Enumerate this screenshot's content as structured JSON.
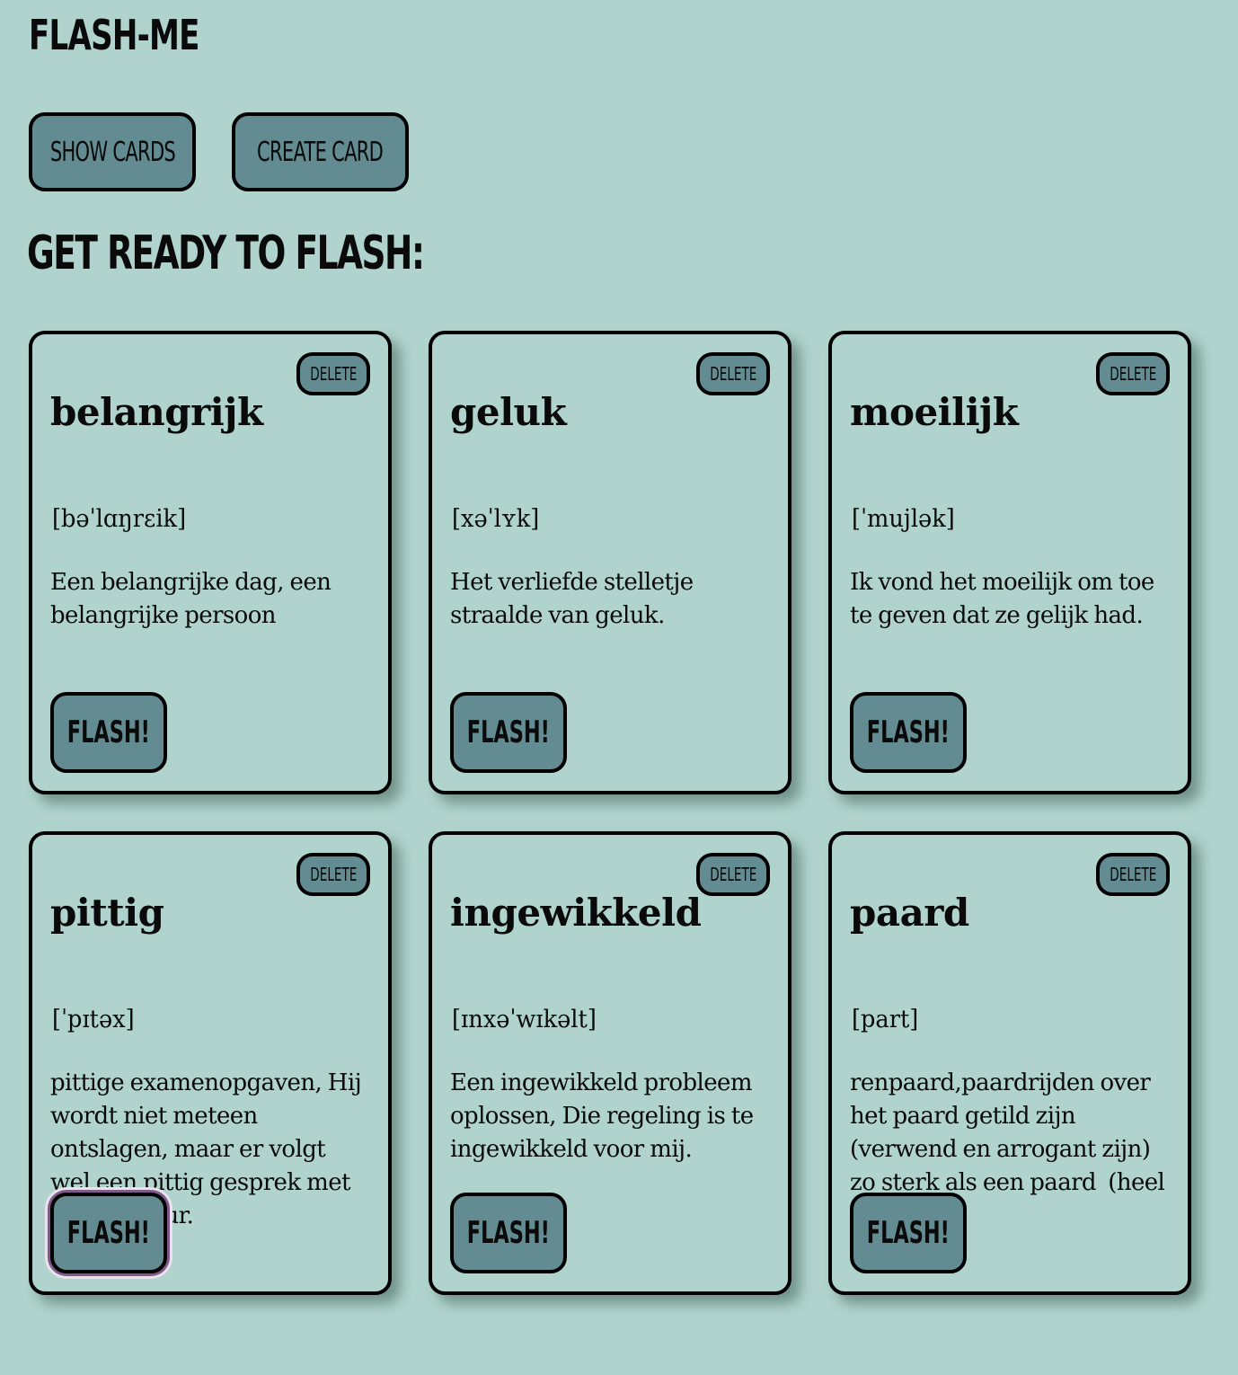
{
  "app": {
    "title": "FLASH-ME"
  },
  "nav": {
    "show_cards": "SHOW CARDS",
    "create_card": "CREATE CARD"
  },
  "heading": "GET READY TO FLASH:",
  "cards": [
    {
      "word": "belangrijk",
      "phonetic": "[bəˈlɑŋrɛik]",
      "example": "Een belangrijke dag, een belangrijke persoon",
      "delete_label": "DELETE",
      "flash_label": "FLASH!"
    },
    {
      "word": "geluk",
      "phonetic": "[xəˈlʏk]",
      "example": "Het verliefde stelletje straalde van geluk.",
      "delete_label": "DELETE",
      "flash_label": "FLASH!"
    },
    {
      "word": "moeilijk",
      "phonetic": "[ˈmujlək]",
      "example": "Ik vond het moeilijk om toe te geven dat ze gelijk had.",
      "delete_label": "DELETE",
      "flash_label": "FLASH!"
    },
    {
      "word": "pittig",
      "phonetic": "[ˈpɪtəx]",
      "example": "pittige examenopgaven, Hij wordt niet meteen ontslagen, maar er volgt wel een pittig gesprek met de directeur.",
      "delete_label": "DELETE",
      "flash_label": "FLASH!"
    },
    {
      "word": "ingewikkeld",
      "phonetic": "[ɪnxəˈwɪkəlt]",
      "example": "Een ingewikkeld probleem oplossen, Die regeling is te ingewikkeld voor mij.",
      "delete_label": "DELETE",
      "flash_label": "FLASH!"
    },
    {
      "word": "paard",
      "phonetic": "[part]",
      "example": "renpaard,paardrijden over het paard getild zijn (verwend en arrogant zijn) zo sterk als een paard  (heel sterk),",
      "delete_label": "DELETE",
      "flash_label": "FLASH!"
    }
  ],
  "colors": {
    "background": "#b0d4cd",
    "button": "#628c91",
    "border": "#000000",
    "focus_ring": "#7e5a8a"
  }
}
